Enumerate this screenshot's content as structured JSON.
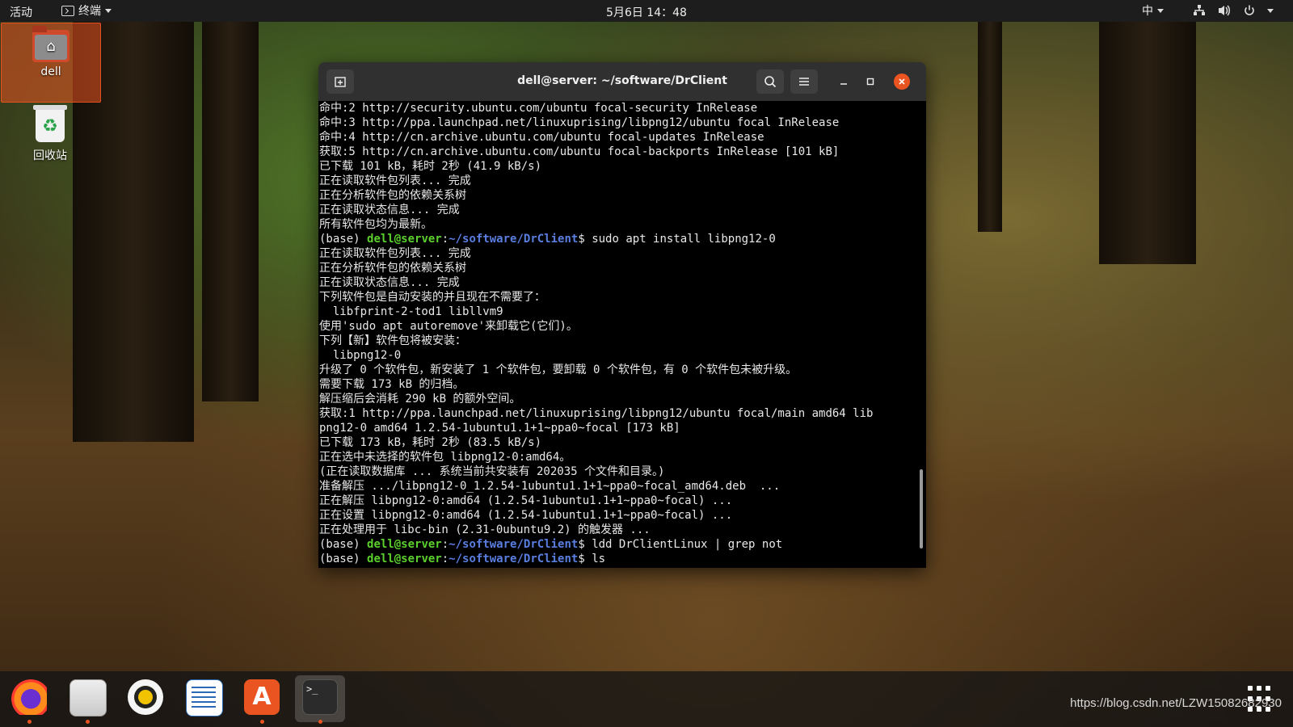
{
  "topbar": {
    "activities": "活动",
    "app_menu": "终端",
    "clock": "5月6日 14：48",
    "input_method": "中",
    "icons": [
      "network-icon",
      "volume-icon",
      "power-icon"
    ]
  },
  "desktop": {
    "home_label": "dell",
    "trash_label": "回收站"
  },
  "terminal": {
    "title": "dell@server: ~/software/DrClient",
    "prompt_prefix": "(base) ",
    "prompt_user": "dell@server",
    "prompt_colon": ":",
    "prompt_path": "~/software/DrClient",
    "prompt_dollar": "$ ",
    "lines": [
      {
        "text": "命中:2 http://security.ubuntu.com/ubuntu focal-security InRelease"
      },
      {
        "text": "命中:3 http://ppa.launchpad.net/linuxuprising/libpng12/ubuntu focal InRelease"
      },
      {
        "text": "命中:4 http://cn.archive.ubuntu.com/ubuntu focal-updates InRelease"
      },
      {
        "text": "获取:5 http://cn.archive.ubuntu.com/ubuntu focal-backports InRelease [101 kB]"
      },
      {
        "text": "已下载 101 kB，耗时 2秒 (41.9 kB/s)"
      },
      {
        "text": "正在读取软件包列表... 完成"
      },
      {
        "text": "正在分析软件包的依赖关系树"
      },
      {
        "text": "正在读取状态信息... 完成"
      },
      {
        "text": "所有软件包均为最新。"
      },
      {
        "cmd": "sudo apt install libpng12-0"
      },
      {
        "text": "正在读取软件包列表... 完成"
      },
      {
        "text": "正在分析软件包的依赖关系树"
      },
      {
        "text": "正在读取状态信息... 完成"
      },
      {
        "text": "下列软件包是自动安装的并且现在不需要了："
      },
      {
        "text": "  libfprint-2-tod1 libllvm9"
      },
      {
        "text": "使用'sudo apt autoremove'来卸载它(它们)。"
      },
      {
        "text": "下列【新】软件包将被安装："
      },
      {
        "text": "  libpng12-0"
      },
      {
        "text": "升级了 0 个软件包，新安装了 1 个软件包，要卸载 0 个软件包，有 0 个软件包未被升级。"
      },
      {
        "text": "需要下载 173 kB 的归档。"
      },
      {
        "text": "解压缩后会消耗 290 kB 的额外空间。"
      },
      {
        "text": "获取:1 http://ppa.launchpad.net/linuxuprising/libpng12/ubuntu focal/main amd64 lib"
      },
      {
        "text": "png12-0 amd64 1.2.54-1ubuntu1.1+1~ppa0~focal [173 kB]"
      },
      {
        "text": "已下载 173 kB，耗时 2秒 (83.5 kB/s)"
      },
      {
        "text": "正在选中未选择的软件包 libpng12-0:amd64。"
      },
      {
        "text": "(正在读取数据库 ... 系统当前共安装有 202035 个文件和目录。)"
      },
      {
        "text": "准备解压 .../libpng12-0_1.2.54-1ubuntu1.1+1~ppa0~focal_amd64.deb  ..."
      },
      {
        "text": "正在解压 libpng12-0:amd64 (1.2.54-1ubuntu1.1+1~ppa0~focal) ..."
      },
      {
        "text": "正在设置 libpng12-0:amd64 (1.2.54-1ubuntu1.1+1~ppa0~focal) ..."
      },
      {
        "text": "正在处理用于 libc-bin (2.31-0ubuntu9.2) 的触发器 ..."
      },
      {
        "cmd": "ldd DrClientLinux | grep not"
      },
      {
        "cmd": "ls"
      }
    ]
  },
  "dock": {
    "apps": [
      "firefox-icon",
      "files-icon",
      "rhythmbox-icon",
      "writer-icon",
      "software-store-icon",
      "terminal-icon"
    ],
    "terminal_glyph": ">_"
  },
  "watermark": "https://blog.csdn.net/LZW15082682930",
  "colors": {
    "accent": "#e95420",
    "prompt_user": "#5bd02c",
    "prompt_path": "#5a7ee0",
    "terminal_bg": "#000000"
  }
}
